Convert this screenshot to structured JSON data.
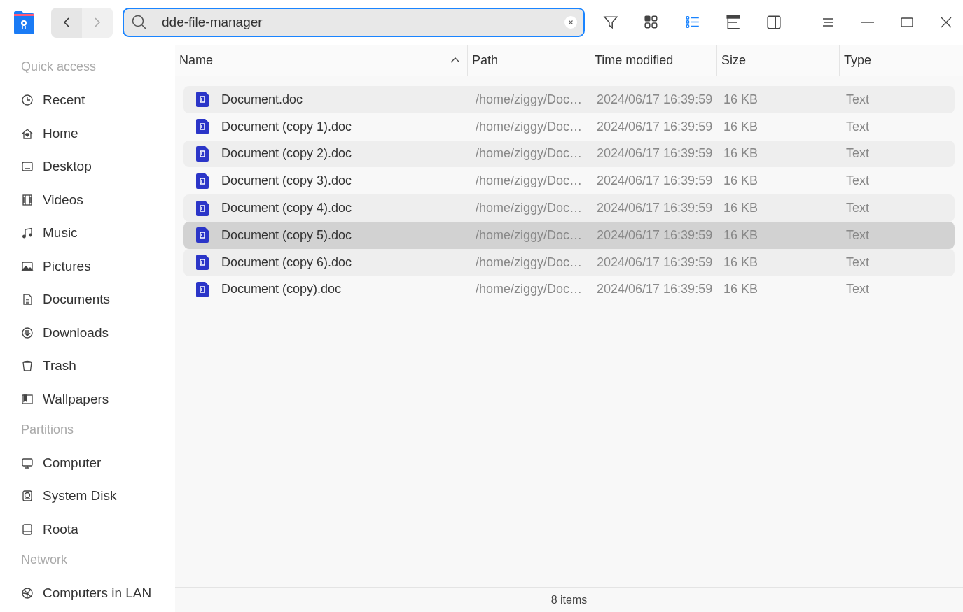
{
  "navigation": {
    "back": {
      "disabled": false
    },
    "forward": {
      "disabled": true
    }
  },
  "search": {
    "value": "dde-file-manager"
  },
  "view_modes": [
    {
      "kind": "icons",
      "selected": false
    },
    {
      "kind": "list",
      "selected": true
    },
    {
      "kind": "tree",
      "selected": false
    }
  ],
  "sidebar": {
    "sections": [
      {
        "title": "Quick access",
        "items": [
          {
            "label": "Recent",
            "kind": "clock"
          },
          {
            "label": "Home",
            "kind": "home"
          },
          {
            "label": "Desktop",
            "kind": "desktop"
          },
          {
            "label": "Videos",
            "kind": "film"
          },
          {
            "label": "Music",
            "kind": "music"
          },
          {
            "label": "Pictures",
            "kind": "picture"
          },
          {
            "label": "Documents",
            "kind": "document"
          },
          {
            "label": "Downloads",
            "kind": "download"
          },
          {
            "label": "Trash",
            "kind": "trash"
          },
          {
            "label": "Wallpapers",
            "kind": "wallpaper"
          }
        ]
      },
      {
        "title": "Partitions",
        "items": [
          {
            "label": "Computer",
            "kind": "monitor"
          },
          {
            "label": "System Disk",
            "kind": "disk"
          },
          {
            "label": "Roota",
            "kind": "drive"
          }
        ]
      },
      {
        "title": "Network",
        "items": [
          {
            "label": "Computers in LAN",
            "kind": "network"
          }
        ]
      }
    ]
  },
  "table": {
    "columns": [
      {
        "label": "Name",
        "sorted": true
      },
      {
        "label": "Path",
        "sorted": false
      },
      {
        "label": "Time modified",
        "sorted": false
      },
      {
        "label": "Size",
        "sorted": false
      },
      {
        "label": "Type",
        "sorted": false
      }
    ],
    "rows": [
      {
        "name": "Document.doc",
        "path": "/home/ziggy/Doc…",
        "modified": "2024/06/17 16:39:59",
        "size": "16 KB",
        "type": "Text",
        "selected": false
      },
      {
        "name": "Document (copy 1).doc",
        "path": "/home/ziggy/Doc…",
        "modified": "2024/06/17 16:39:59",
        "size": "16 KB",
        "type": "Text",
        "selected": false
      },
      {
        "name": "Document (copy 2).doc",
        "path": "/home/ziggy/Doc…",
        "modified": "2024/06/17 16:39:59",
        "size": "16 KB",
        "type": "Text",
        "selected": false
      },
      {
        "name": "Document (copy 3).doc",
        "path": "/home/ziggy/Doc…",
        "modified": "2024/06/17 16:39:59",
        "size": "16 KB",
        "type": "Text",
        "selected": false
      },
      {
        "name": "Document (copy 4).doc",
        "path": "/home/ziggy/Doc…",
        "modified": "2024/06/17 16:39:59",
        "size": "16 KB",
        "type": "Text",
        "selected": false
      },
      {
        "name": "Document (copy 5).doc",
        "path": "/home/ziggy/Doc…",
        "modified": "2024/06/17 16:39:59",
        "size": "16 KB",
        "type": "Text",
        "selected": true
      },
      {
        "name": "Document (copy 6).doc",
        "path": "/home/ziggy/Doc…",
        "modified": "2024/06/17 16:39:59",
        "size": "16 KB",
        "type": "Text",
        "selected": false
      },
      {
        "name": "Document (copy).doc",
        "path": "/home/ziggy/Doc…",
        "modified": "2024/06/17 16:39:59",
        "size": "16 KB",
        "type": "Text",
        "selected": false
      }
    ]
  },
  "status_bar": {
    "count": "8 items"
  }
}
